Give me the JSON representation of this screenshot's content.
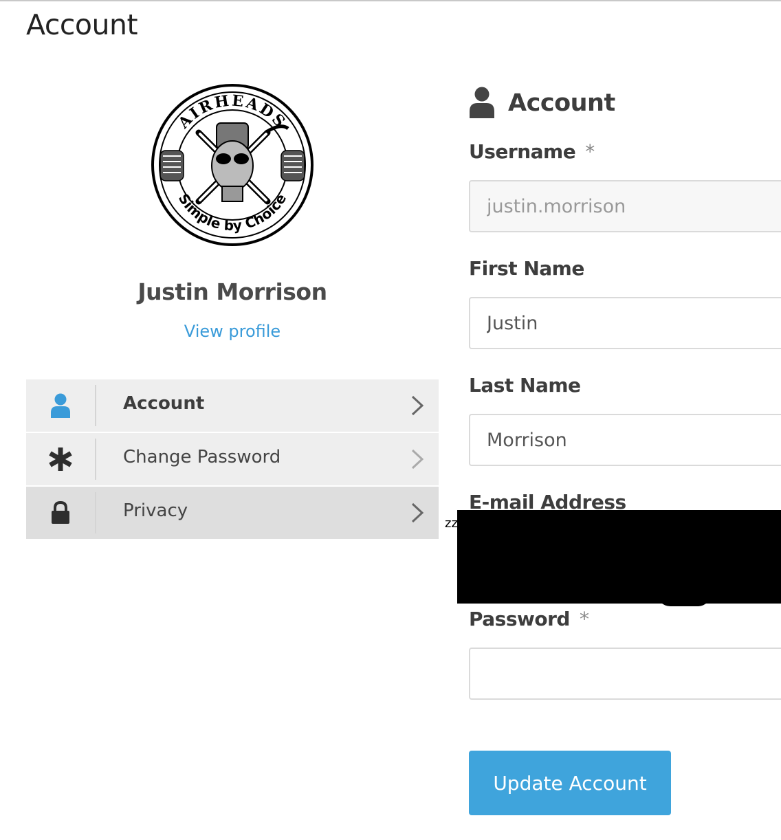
{
  "page": {
    "title": "Account"
  },
  "profile": {
    "avatar_texts": {
      "top": "AIRHEADS",
      "bottom": "Simple by Choice"
    },
    "name": "Justin Morrison",
    "view_profile_link": "View profile"
  },
  "menu": {
    "items": [
      {
        "icon": "user-icon",
        "label": "Account",
        "active": true
      },
      {
        "icon": "asterisk-icon",
        "label": "Change Password",
        "active": false
      },
      {
        "icon": "lock-icon",
        "label": "Privacy",
        "active": false
      }
    ]
  },
  "form": {
    "title": "Account",
    "title_icon": "user-icon",
    "required_mark": "*",
    "username": {
      "label": "Username",
      "value": "justin.morrison",
      "required": true,
      "disabled": true
    },
    "first_name": {
      "label": "First Name",
      "value": "Justin"
    },
    "last_name": {
      "label": "Last Name",
      "value": "Morrison"
    },
    "email": {
      "label": "E-mail Address",
      "partial_text": "zz"
    },
    "password": {
      "label": "Password",
      "value": "",
      "required": true
    },
    "submit_label": "Update Account"
  },
  "colors": {
    "accent": "#3fa4dc",
    "link": "#3a9bd9",
    "menu_bg": "#eeeeee",
    "menu_bg_hover": "#dedede"
  }
}
